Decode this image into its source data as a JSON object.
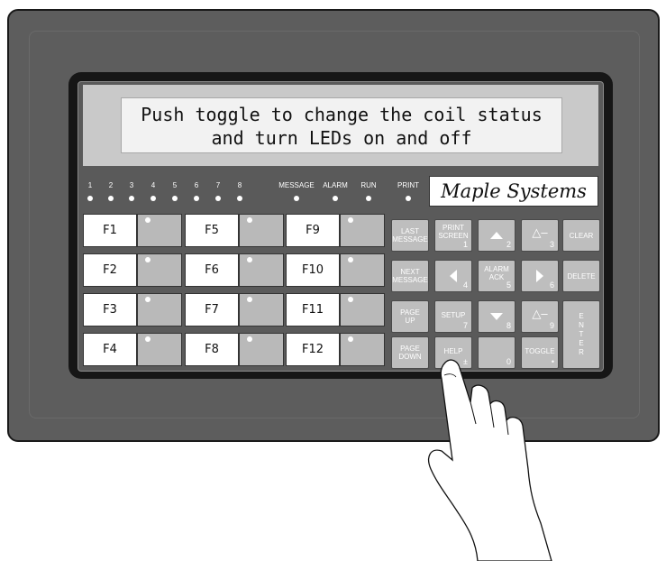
{
  "display": {
    "line1": "Push toggle to change the coil status",
    "line2": "and turn LEDs on and off"
  },
  "indicators": [
    {
      "label": "1"
    },
    {
      "label": "2"
    },
    {
      "label": "3"
    },
    {
      "label": "4"
    },
    {
      "label": "5"
    },
    {
      "label": "6"
    },
    {
      "label": "7"
    },
    {
      "label": "8"
    },
    {
      "label": "MESSAGE"
    },
    {
      "label": "ALARM"
    },
    {
      "label": "RUN"
    },
    {
      "label": "PRINT"
    }
  ],
  "logo": {
    "text": "Maple Systems"
  },
  "function_keys": [
    "F1",
    "F2",
    "F3",
    "F4",
    "F5",
    "F6",
    "F7",
    "F8",
    "F9",
    "F10",
    "F11",
    "F12"
  ],
  "keypad": {
    "last_message": "LAST\nMESSAGE",
    "print_screen": "PRINT\nSCREEN",
    "print_screen_num": "1",
    "up_num": "2",
    "minus_top": "△–",
    "minus_top_num": "3",
    "clear": "CLEAR",
    "next_message": "NEXT\nMESSAGE",
    "left_num": "4",
    "alarm_ack": "ALARM\nACK",
    "alarm_ack_num": "5",
    "right_num": "6",
    "delete": "DELETE",
    "page_up": "PAGE\nUP",
    "setup": "SETUP",
    "setup_num": "7",
    "down_num": "8",
    "minus_bottom": "△–",
    "minus_bottom_num": "9",
    "enter": "E\nN\nT\nE\nR",
    "page_down": "PAGE\nDOWN",
    "help": "HELP",
    "help_num": "±",
    "zero_num": "0",
    "toggle": "TOGGLE",
    "toggle_num": "•"
  }
}
